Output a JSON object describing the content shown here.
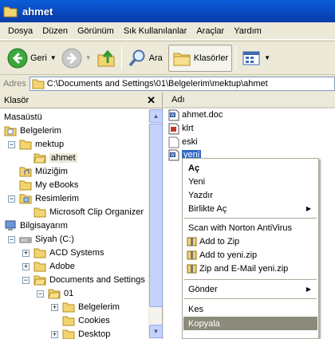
{
  "window": {
    "title": "ahmet"
  },
  "menu": [
    "Dosya",
    "Düzen",
    "Görünüm",
    "Sık Kullanılanlar",
    "Araçlar",
    "Yardım"
  ],
  "toolbar": {
    "back": "Geri",
    "search": "Ara",
    "folders": "Klasörler"
  },
  "address": {
    "label": "Adres",
    "path": "C:\\Documents and Settings\\01\\Belgelerim\\mektup\\ahmet"
  },
  "folders_pane": {
    "header": "Klasör",
    "items": [
      "Masaüstü",
      "Belgelerim",
      "mektup",
      "ahmet",
      "Müziğim",
      "My eBooks",
      "Resimlerim",
      "Microsoft Clip Organizer",
      "Bilgisayarım",
      "Siyah (C:)",
      "ACD Systems",
      "Adobe",
      "Documents and Settings",
      "01",
      "Belgelerim",
      "Cookies",
      "Desktop"
    ]
  },
  "files_pane": {
    "header": "Adı",
    "files": [
      "ahmet.doc",
      "klrt",
      "eski",
      "yeni"
    ]
  },
  "context_menu": {
    "items": [
      "Aç",
      "Yeni",
      "Yazdır",
      "Birlikte Aç",
      "Scan with Norton AntiVirus",
      "Add to Zip",
      "Add to yeni.zip",
      "Zip and E-Mail yeni.zip",
      "Gönder",
      "Kes",
      "Kopyala"
    ]
  }
}
